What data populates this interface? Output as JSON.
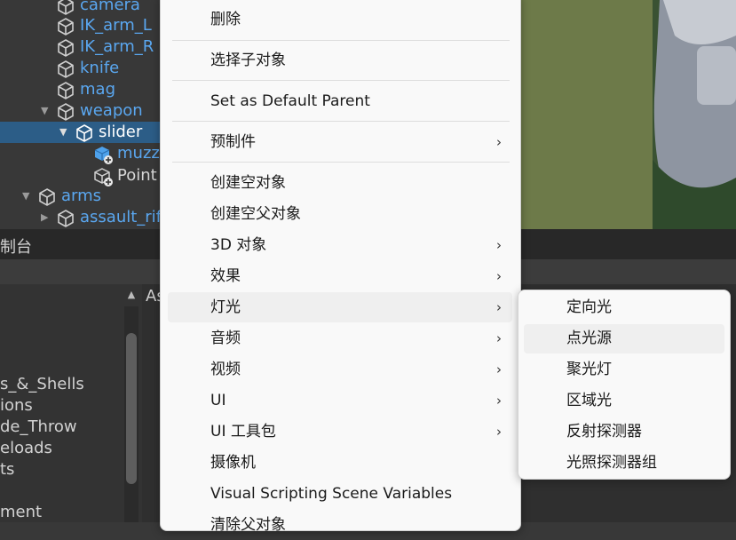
{
  "hierarchy": {
    "items": [
      {
        "label": "camera"
      },
      {
        "label": "IK_arm_L"
      },
      {
        "label": "IK_arm_R"
      },
      {
        "label": "knife"
      },
      {
        "label": "mag"
      },
      {
        "label": "weapon"
      },
      {
        "label": "slider"
      },
      {
        "label": "muzz"
      },
      {
        "label": "Point"
      },
      {
        "label": "arms"
      },
      {
        "label": "assault_rif"
      }
    ]
  },
  "console": {
    "title": "制台",
    "right_label": "As",
    "list": [
      "s_&_Shells",
      "ions",
      "de_Throw",
      "eloads",
      "ts",
      "ment"
    ]
  },
  "context_menu": {
    "items": [
      {
        "label": "删除"
      },
      {
        "label": "选择子对象"
      },
      {
        "label": "Set as Default Parent"
      },
      {
        "label": "预制件",
        "chevron": "›"
      },
      {
        "label": "创建空对象"
      },
      {
        "label": "创建空父对象"
      },
      {
        "label": "3D 对象",
        "chevron": "›"
      },
      {
        "label": "效果",
        "chevron": "›"
      },
      {
        "label": "灯光",
        "chevron": "›"
      },
      {
        "label": "音频",
        "chevron": "›"
      },
      {
        "label": "视频",
        "chevron": "›"
      },
      {
        "label": "UI",
        "chevron": "›"
      },
      {
        "label": "UI 工具包",
        "chevron": "›"
      },
      {
        "label": "摄像机"
      },
      {
        "label": "Visual Scripting Scene Variables"
      },
      {
        "label": "清除父对象"
      }
    ]
  },
  "light_submenu": {
    "items": [
      {
        "label": "定向光"
      },
      {
        "label": "点光源"
      },
      {
        "label": "聚光灯"
      },
      {
        "label": "区域光"
      },
      {
        "label": "反射探测器"
      },
      {
        "label": "光照探测器组"
      }
    ]
  },
  "colors": {
    "selection": "#2c5d87",
    "prefab_text": "#5aa7f0",
    "menu_bg": "#f9f9f9",
    "hover_bg": "#efefef"
  }
}
